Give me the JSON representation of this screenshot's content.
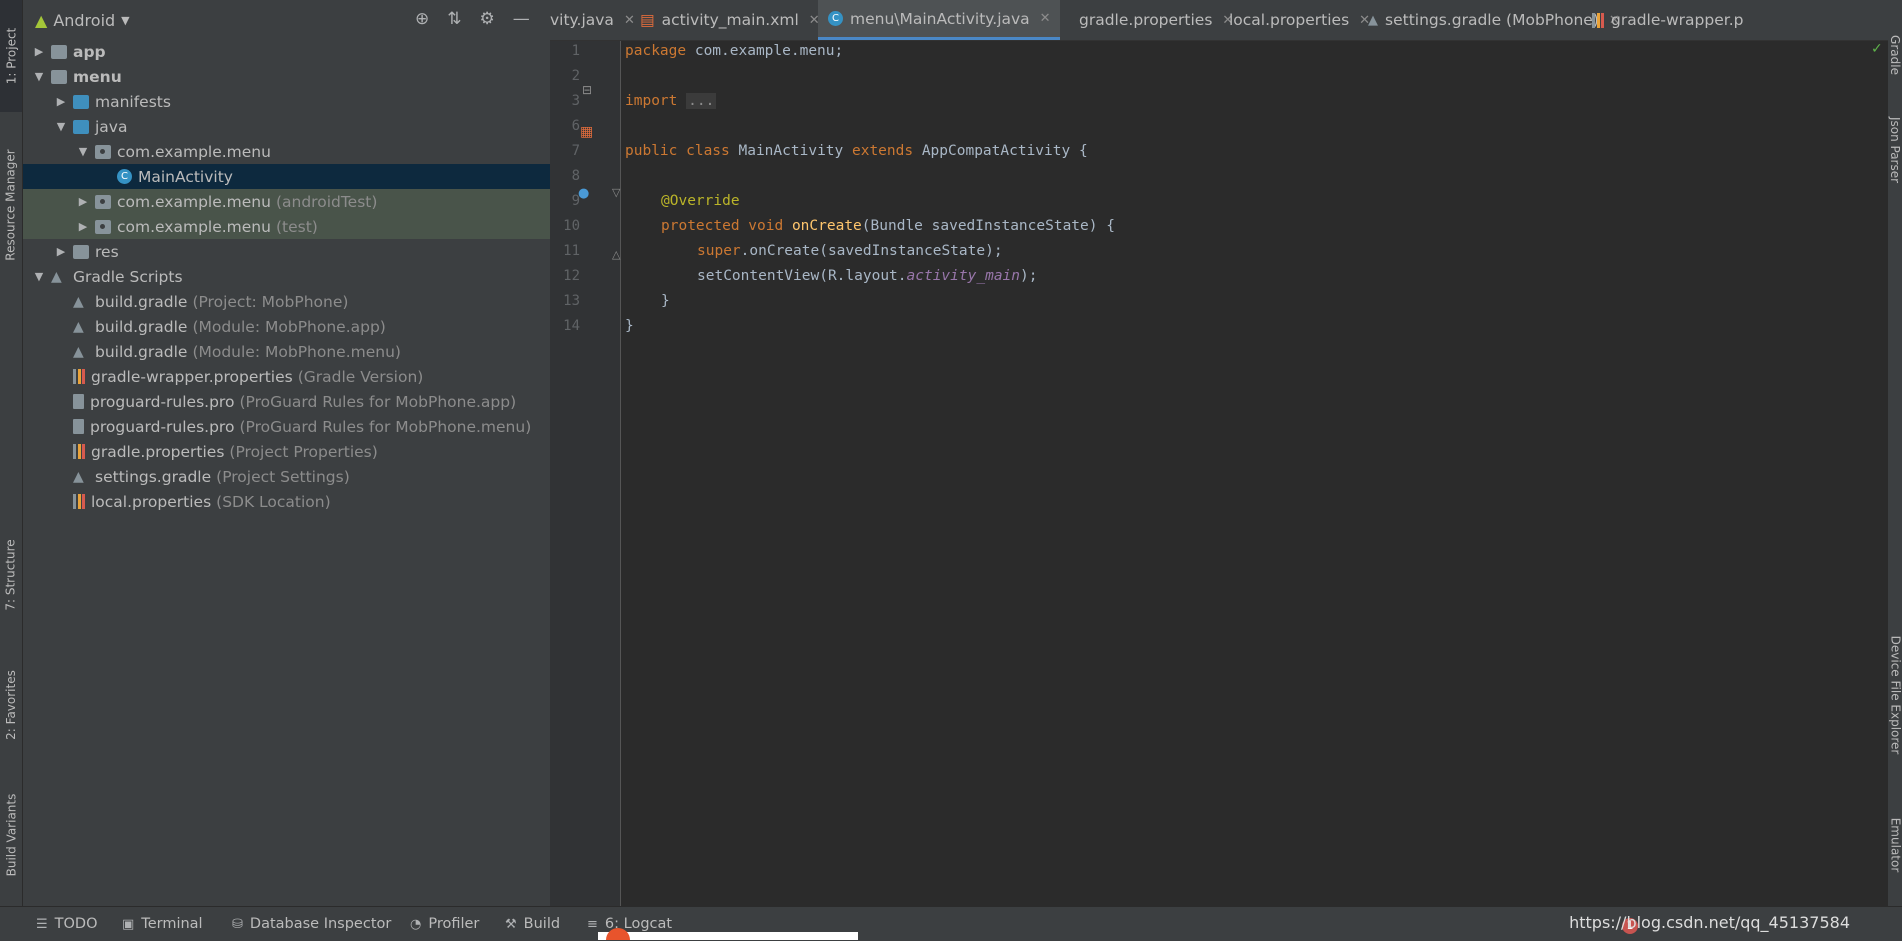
{
  "left_strip": {
    "tabs": [
      "1: Project",
      "Resource Manager",
      "7: Structure",
      "2: Favorites",
      "Build Variants"
    ]
  },
  "right_strip": {
    "tabs": [
      "Gradle",
      "Json Parser",
      "Device File Explorer",
      "Emulator"
    ]
  },
  "project_panel": {
    "view_label": "Android",
    "tree": [
      {
        "label": "app",
        "suffix": "",
        "bold": true,
        "icon": "module-folder-icon",
        "expanded": false,
        "level": 0
      },
      {
        "label": "menu",
        "suffix": "",
        "bold": true,
        "icon": "module-folder-icon",
        "expanded": true,
        "level": 0
      },
      {
        "label": "manifests",
        "suffix": "",
        "icon": "folder-icon",
        "expanded": false,
        "level": 1
      },
      {
        "label": "java",
        "suffix": "",
        "icon": "source-folder-icon",
        "expanded": true,
        "level": 1
      },
      {
        "label": "com.example.menu",
        "suffix": "",
        "icon": "package-icon",
        "expanded": true,
        "level": 2
      },
      {
        "label": "MainActivity",
        "suffix": "",
        "icon": "class-icon",
        "selected": true,
        "level": 3
      },
      {
        "label": "com.example.menu",
        "suffix": "(androidTest)",
        "icon": "package-icon",
        "expanded": false,
        "test": true,
        "level": 2
      },
      {
        "label": "com.example.menu",
        "suffix": "(test)",
        "icon": "package-icon",
        "expanded": false,
        "test": true,
        "level": 2
      },
      {
        "label": "res",
        "suffix": "",
        "icon": "resource-folder-icon",
        "expanded": false,
        "level": 1
      },
      {
        "label": "Gradle Scripts",
        "suffix": "",
        "icon": "gradle-icon",
        "expanded": true,
        "level": 0
      },
      {
        "label": "build.gradle",
        "suffix": "(Project: MobPhone)",
        "icon": "gradle-icon",
        "level": 1
      },
      {
        "label": "build.gradle",
        "suffix": "(Module: MobPhone.app)",
        "icon": "gradle-icon",
        "level": 1
      },
      {
        "label": "build.gradle",
        "suffix": "(Module: MobPhone.menu)",
        "icon": "gradle-icon",
        "level": 1
      },
      {
        "label": "gradle-wrapper.properties",
        "suffix": "(Gradle Version)",
        "icon": "properties-icon",
        "level": 1
      },
      {
        "label": "proguard-rules.pro",
        "suffix": "(ProGuard Rules for MobPhone.app)",
        "icon": "file-icon",
        "level": 1
      },
      {
        "label": "proguard-rules.pro",
        "suffix": "(ProGuard Rules for MobPhone.menu)",
        "icon": "file-icon",
        "level": 1
      },
      {
        "label": "gradle.properties",
        "suffix": "(Project Properties)",
        "icon": "properties-icon",
        "level": 1
      },
      {
        "label": "settings.gradle",
        "suffix": "(Project Settings)",
        "icon": "gradle-icon",
        "level": 1
      },
      {
        "label": "local.properties",
        "suffix": "(SDK Location)",
        "icon": "properties-icon",
        "level": 1
      }
    ]
  },
  "editor_tabs": [
    {
      "label": "vity.java",
      "icon": "",
      "active": false
    },
    {
      "label": "activity_main.xml",
      "icon": "xml-icon",
      "active": false
    },
    {
      "label": "menu\\MainActivity.java",
      "icon": "class-icon",
      "active": true
    },
    {
      "label": "gradle.properties",
      "icon": "properties-icon",
      "active": false
    },
    {
      "label": "local.properties",
      "icon": "properties-icon",
      "active": false
    },
    {
      "label": "settings.gradle (MobPhone)",
      "icon": "gradle-icon",
      "active": false
    },
    {
      "label": "gradle-wrapper.p",
      "icon": "properties-icon",
      "active": false
    }
  ],
  "line_numbers": [
    "1",
    "2",
    "3",
    "6",
    "7",
    "8",
    "9",
    "10",
    "11",
    "12",
    "13",
    "14"
  ],
  "code": {
    "l1_kw": "package",
    "l1_rest": " com.example.menu;",
    "l3_kw": "import",
    "l3_fold": "...",
    "l7_kw1": "public class",
    "l7_name": " MainActivity ",
    "l7_kw2": "extends",
    "l7_rest": " AppCompatActivity {",
    "l9_ann": "@Override",
    "l10_kw": "protected void",
    "l10_fn": "onCreate",
    "l10_rest": "(Bundle savedInstanceState) {",
    "l11_kw": "super",
    "l11_rest": ".onCreate(savedInstanceState);",
    "l12_a": "setContentView(R.layout.",
    "l12_it": "activity_main",
    "l12_b": ");",
    "l13": "}",
    "l14": "}"
  },
  "bottom_bar": {
    "tabs": [
      {
        "label": "TODO",
        "icon": "list-icon"
      },
      {
        "label": "Terminal",
        "icon": "terminal-icon"
      },
      {
        "label": "Database Inspector",
        "icon": "database-icon"
      },
      {
        "label": "Profiler",
        "icon": "profiler-icon"
      },
      {
        "label": "Build",
        "icon": "hammer-icon"
      },
      {
        "label": "6: Logcat",
        "icon": "logcat-icon"
      }
    ],
    "error_count": "1",
    "watermark": "https://blog.csdn.net/qq_45137584"
  }
}
